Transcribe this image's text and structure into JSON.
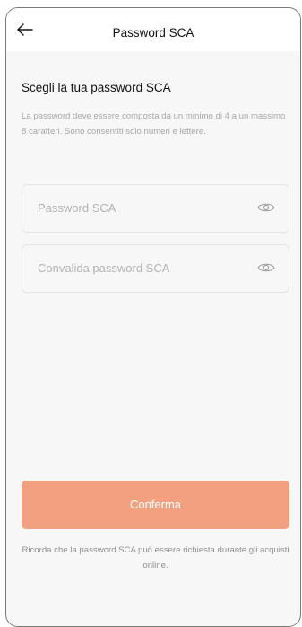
{
  "header": {
    "title": "Password SCA",
    "back_icon": "arrow-left-icon"
  },
  "content": {
    "heading": "Scegli la tua password SCA",
    "helper_text": "La password deve essere composta da un minimo di 4 a un massimo 8 caratteri. Sono consentiti solo numeri e lettere."
  },
  "form": {
    "password": {
      "placeholder": "Password SCA",
      "value": "",
      "icon": "eye-icon"
    },
    "confirm_password": {
      "placeholder": "Convalida password SCA",
      "value": "",
      "icon": "eye-icon"
    },
    "confirm_button_label": "Conferma"
  },
  "footer": {
    "note": "Ricorda che la password SCA può essere richiesta durante gli acquisti online."
  },
  "colors": {
    "accent": "#f2a07f",
    "background": "#f7f7f7",
    "text": "#111111",
    "muted": "#a7a7a7"
  }
}
